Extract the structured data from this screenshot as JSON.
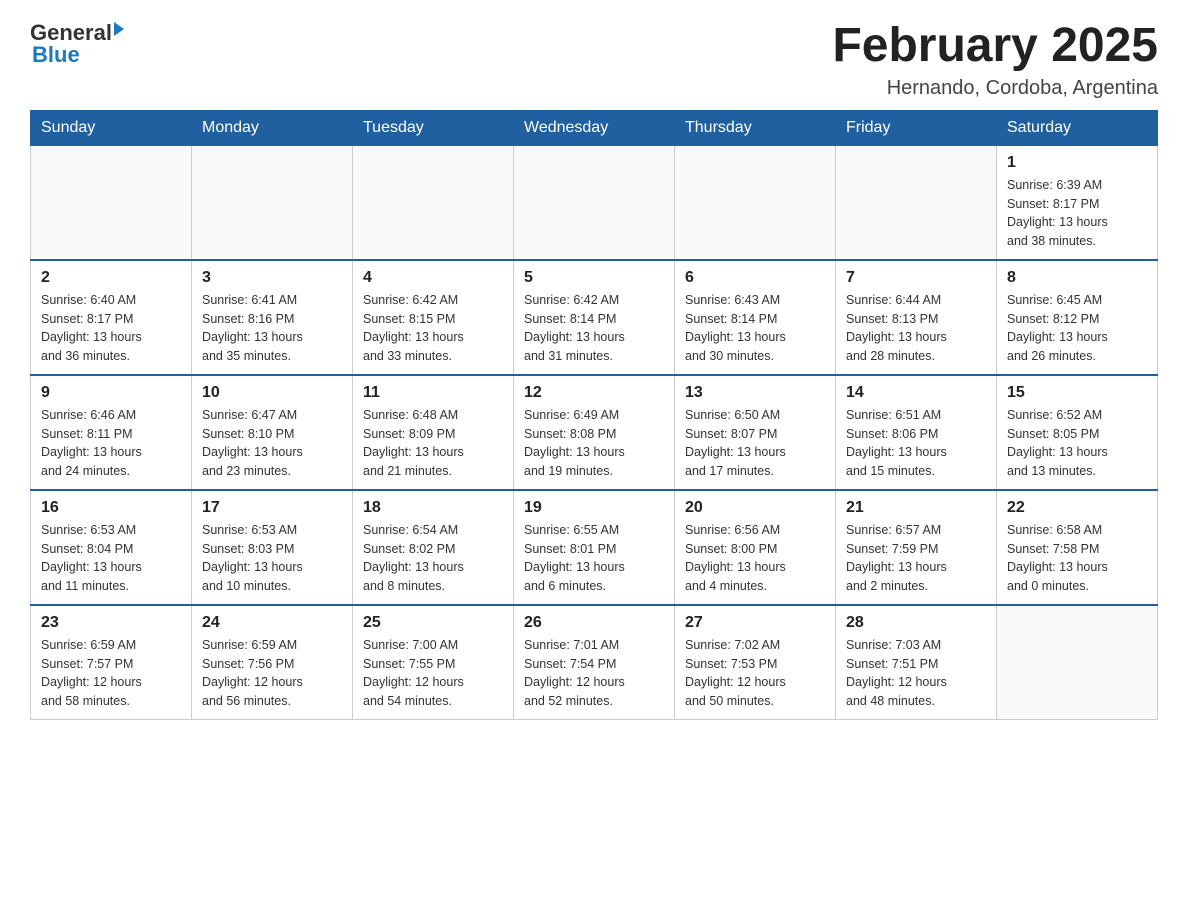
{
  "header": {
    "title": "February 2025",
    "subtitle": "Hernando, Cordoba, Argentina",
    "logo_general": "General",
    "logo_blue": "Blue"
  },
  "weekdays": [
    "Sunday",
    "Monday",
    "Tuesday",
    "Wednesday",
    "Thursday",
    "Friday",
    "Saturday"
  ],
  "weeks": [
    [
      {
        "day": "",
        "info": ""
      },
      {
        "day": "",
        "info": ""
      },
      {
        "day": "",
        "info": ""
      },
      {
        "day": "",
        "info": ""
      },
      {
        "day": "",
        "info": ""
      },
      {
        "day": "",
        "info": ""
      },
      {
        "day": "1",
        "info": "Sunrise: 6:39 AM\nSunset: 8:17 PM\nDaylight: 13 hours\nand 38 minutes."
      }
    ],
    [
      {
        "day": "2",
        "info": "Sunrise: 6:40 AM\nSunset: 8:17 PM\nDaylight: 13 hours\nand 36 minutes."
      },
      {
        "day": "3",
        "info": "Sunrise: 6:41 AM\nSunset: 8:16 PM\nDaylight: 13 hours\nand 35 minutes."
      },
      {
        "day": "4",
        "info": "Sunrise: 6:42 AM\nSunset: 8:15 PM\nDaylight: 13 hours\nand 33 minutes."
      },
      {
        "day": "5",
        "info": "Sunrise: 6:42 AM\nSunset: 8:14 PM\nDaylight: 13 hours\nand 31 minutes."
      },
      {
        "day": "6",
        "info": "Sunrise: 6:43 AM\nSunset: 8:14 PM\nDaylight: 13 hours\nand 30 minutes."
      },
      {
        "day": "7",
        "info": "Sunrise: 6:44 AM\nSunset: 8:13 PM\nDaylight: 13 hours\nand 28 minutes."
      },
      {
        "day": "8",
        "info": "Sunrise: 6:45 AM\nSunset: 8:12 PM\nDaylight: 13 hours\nand 26 minutes."
      }
    ],
    [
      {
        "day": "9",
        "info": "Sunrise: 6:46 AM\nSunset: 8:11 PM\nDaylight: 13 hours\nand 24 minutes."
      },
      {
        "day": "10",
        "info": "Sunrise: 6:47 AM\nSunset: 8:10 PM\nDaylight: 13 hours\nand 23 minutes."
      },
      {
        "day": "11",
        "info": "Sunrise: 6:48 AM\nSunset: 8:09 PM\nDaylight: 13 hours\nand 21 minutes."
      },
      {
        "day": "12",
        "info": "Sunrise: 6:49 AM\nSunset: 8:08 PM\nDaylight: 13 hours\nand 19 minutes."
      },
      {
        "day": "13",
        "info": "Sunrise: 6:50 AM\nSunset: 8:07 PM\nDaylight: 13 hours\nand 17 minutes."
      },
      {
        "day": "14",
        "info": "Sunrise: 6:51 AM\nSunset: 8:06 PM\nDaylight: 13 hours\nand 15 minutes."
      },
      {
        "day": "15",
        "info": "Sunrise: 6:52 AM\nSunset: 8:05 PM\nDaylight: 13 hours\nand 13 minutes."
      }
    ],
    [
      {
        "day": "16",
        "info": "Sunrise: 6:53 AM\nSunset: 8:04 PM\nDaylight: 13 hours\nand 11 minutes."
      },
      {
        "day": "17",
        "info": "Sunrise: 6:53 AM\nSunset: 8:03 PM\nDaylight: 13 hours\nand 10 minutes."
      },
      {
        "day": "18",
        "info": "Sunrise: 6:54 AM\nSunset: 8:02 PM\nDaylight: 13 hours\nand 8 minutes."
      },
      {
        "day": "19",
        "info": "Sunrise: 6:55 AM\nSunset: 8:01 PM\nDaylight: 13 hours\nand 6 minutes."
      },
      {
        "day": "20",
        "info": "Sunrise: 6:56 AM\nSunset: 8:00 PM\nDaylight: 13 hours\nand 4 minutes."
      },
      {
        "day": "21",
        "info": "Sunrise: 6:57 AM\nSunset: 7:59 PM\nDaylight: 13 hours\nand 2 minutes."
      },
      {
        "day": "22",
        "info": "Sunrise: 6:58 AM\nSunset: 7:58 PM\nDaylight: 13 hours\nand 0 minutes."
      }
    ],
    [
      {
        "day": "23",
        "info": "Sunrise: 6:59 AM\nSunset: 7:57 PM\nDaylight: 12 hours\nand 58 minutes."
      },
      {
        "day": "24",
        "info": "Sunrise: 6:59 AM\nSunset: 7:56 PM\nDaylight: 12 hours\nand 56 minutes."
      },
      {
        "day": "25",
        "info": "Sunrise: 7:00 AM\nSunset: 7:55 PM\nDaylight: 12 hours\nand 54 minutes."
      },
      {
        "day": "26",
        "info": "Sunrise: 7:01 AM\nSunset: 7:54 PM\nDaylight: 12 hours\nand 52 minutes."
      },
      {
        "day": "27",
        "info": "Sunrise: 7:02 AM\nSunset: 7:53 PM\nDaylight: 12 hours\nand 50 minutes."
      },
      {
        "day": "28",
        "info": "Sunrise: 7:03 AM\nSunset: 7:51 PM\nDaylight: 12 hours\nand 48 minutes."
      },
      {
        "day": "",
        "info": ""
      }
    ]
  ]
}
